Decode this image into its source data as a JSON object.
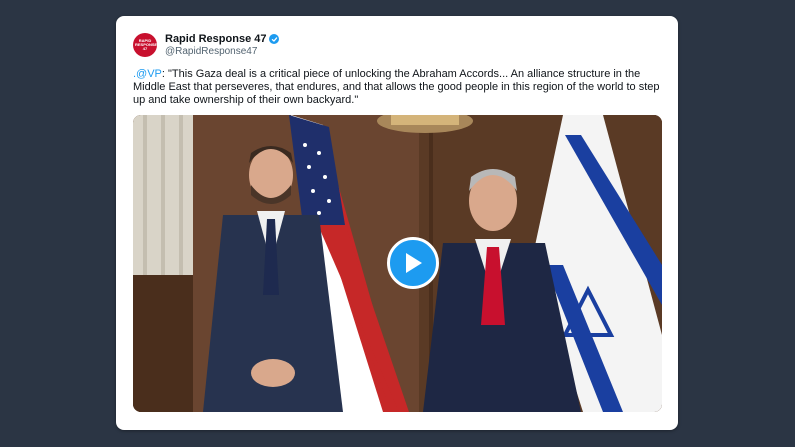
{
  "tweet": {
    "author": {
      "name": "Rapid Response 47",
      "handle": "@RapidResponse47",
      "verified": true,
      "avatar_text": "RAPID RESPONSE 47"
    },
    "mention": ".@VP",
    "text": ": \"This Gaza deal is a critical piece of unlocking the Abraham Accords... An alliance structure in the Middle East that perseveres, that endures, and that allows the good people in this region of the world to step up and take ownership of their own backyard.\"",
    "media": {
      "type": "video",
      "play_icon": "play-icon"
    }
  },
  "colors": {
    "page_background": "#2b3544",
    "card_background": "#ffffff",
    "accent_blue": "#1d9bf0",
    "avatar_red": "#c8102e"
  }
}
